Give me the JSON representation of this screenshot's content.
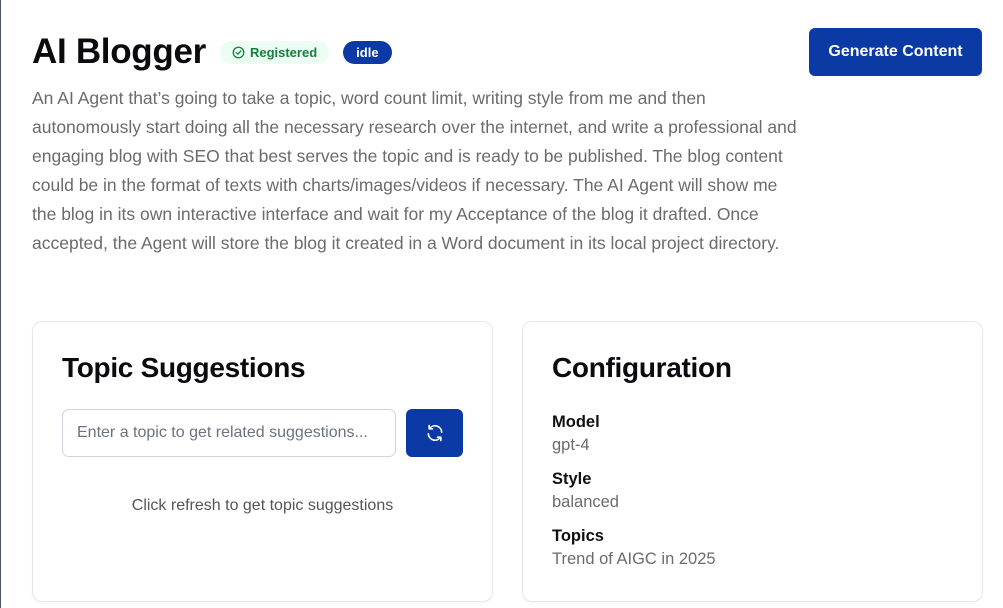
{
  "agent": {
    "title": "AI Blogger",
    "registered_badge": "Registered",
    "status_badge": "idle",
    "generate_label": "Generate Content",
    "description": "An AI Agent that’s going to take a topic, word count limit, writing style from me and then autonomously start doing all the necessary research over the internet, and write a professional and engaging blog with SEO that best serves the topic and is ready to be published. The blog content could be in the format of texts with charts/images/videos if necessary. The AI Agent will show me the blog in its own interactive interface and wait for my Acceptance of the blog it drafted. Once accepted, the Agent will store the blog it created in a Word document in its local project directory."
  },
  "topic_suggestions": {
    "title": "Topic Suggestions",
    "input_value": "",
    "input_placeholder": "Enter a topic to get related suggestions...",
    "refresh_icon": "refresh-icon",
    "hint": "Click refresh to get topic suggestions"
  },
  "configuration": {
    "title": "Configuration",
    "items": [
      {
        "label": "Model",
        "value": "gpt-4"
      },
      {
        "label": "Style",
        "value": "balanced"
      },
      {
        "label": "Topics",
        "value": "Trend of AIGC in 2025"
      }
    ]
  },
  "colors": {
    "primary": "#0b3aa4",
    "registered_bg": "#ecfdf3",
    "registered_text": "#15803d",
    "muted_text": "#6b6b6b"
  }
}
